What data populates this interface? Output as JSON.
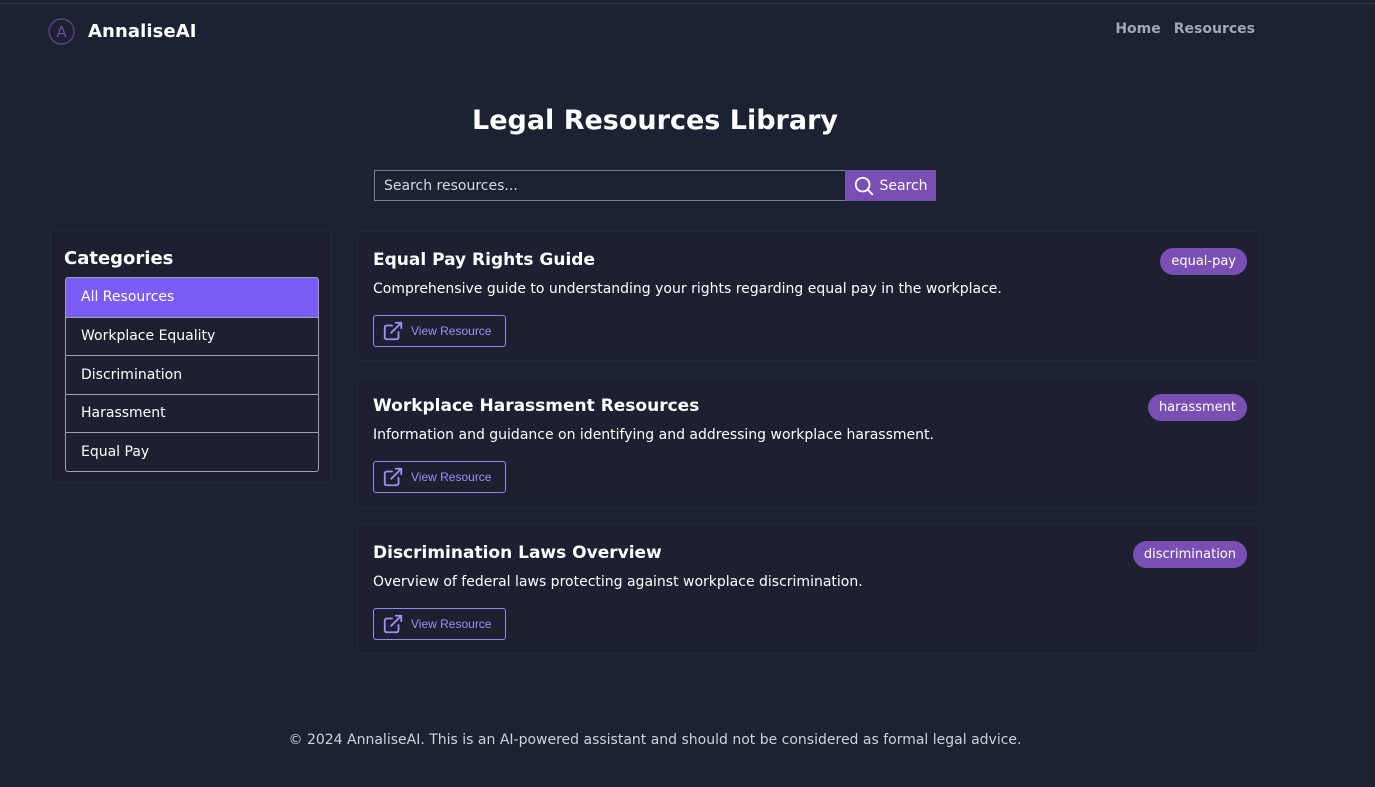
{
  "header": {
    "brand_name": "AnnaliseAI",
    "logo_letter": "A",
    "nav": [
      {
        "label": "Home"
      },
      {
        "label": "Resources"
      }
    ]
  },
  "page": {
    "title": "Legal Resources Library"
  },
  "search": {
    "placeholder": "Search resources...",
    "value": "",
    "button_label": "Search"
  },
  "sidebar": {
    "title": "Categories",
    "items": [
      {
        "label": "All Resources",
        "active": true
      },
      {
        "label": "Workplace Equality",
        "active": false
      },
      {
        "label": "Discrimination",
        "active": false
      },
      {
        "label": "Harassment",
        "active": false
      },
      {
        "label": "Equal Pay",
        "active": false
      }
    ]
  },
  "resources": [
    {
      "title": "Equal Pay Rights Guide",
      "description": "Comprehensive guide to understanding your rights regarding equal pay in the workplace.",
      "tag": "equal-pay",
      "button_label": "View Resource"
    },
    {
      "title": "Workplace Harassment Resources",
      "description": "Information and guidance on identifying and addressing workplace harassment.",
      "tag": "harassment",
      "button_label": "View Resource"
    },
    {
      "title": "Discrimination Laws Overview",
      "description": "Overview of federal laws protecting against workplace discrimination.",
      "tag": "discrimination",
      "button_label": "View Resource"
    }
  ],
  "footer": {
    "text": "© 2024 AnnaliseAI. This is an AI-powered assistant and should not be considered as formal legal advice."
  },
  "colors": {
    "background": "#1d2232",
    "accent": "#7c5cf6",
    "tag": "#7a4fb4",
    "link": "#a48cf6"
  },
  "icons": {
    "logo": "brand-logo-icon",
    "search": "search-icon",
    "view": "external-link-icon"
  }
}
